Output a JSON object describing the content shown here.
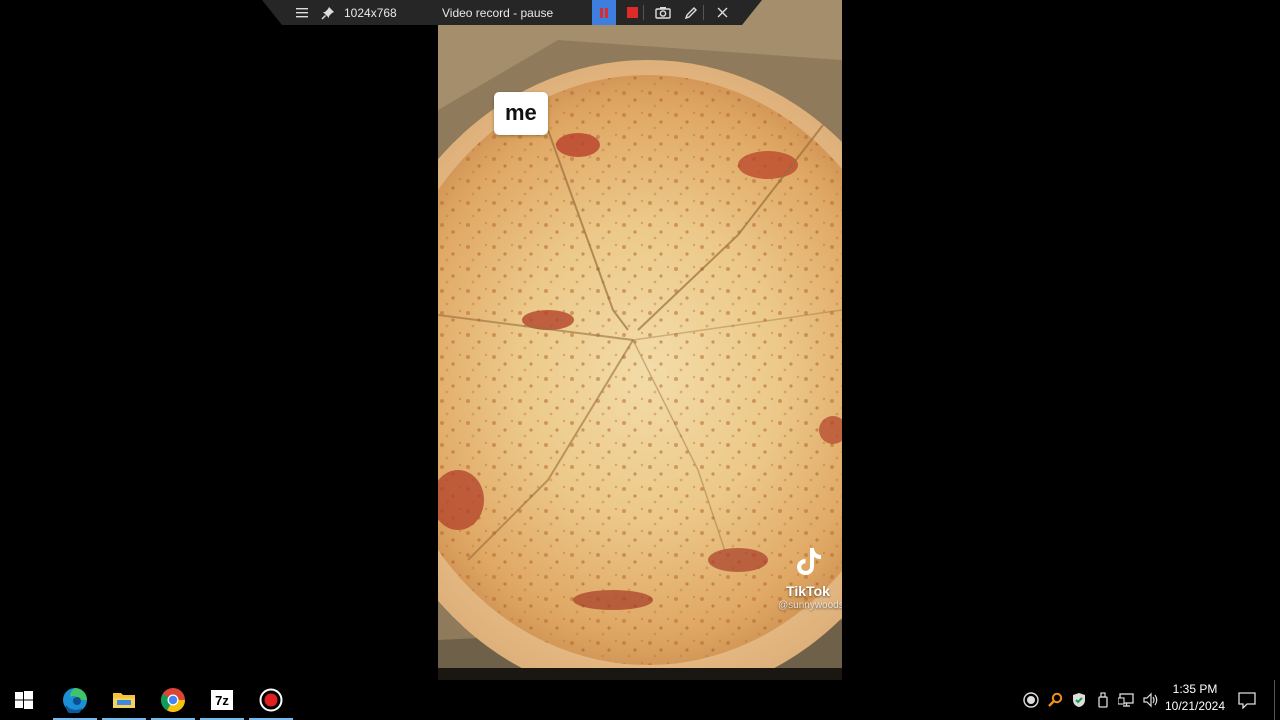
{
  "recorder_toolbar": {
    "resolution": "1024x768",
    "status": "Video record - pause",
    "menu_icon": "hamburger-menu-icon",
    "pin_icon": "pin-icon",
    "pause_icon": "pause-icon",
    "stop_icon": "stop-icon",
    "camera_icon": "camera-icon",
    "pen_icon": "pen-icon",
    "close_icon": "close-icon",
    "pause_color": "#3d7ede",
    "stop_color": "#e02a2a"
  },
  "video": {
    "caption": "me",
    "brand": "TikTok",
    "username": "@sunnywoods"
  },
  "taskbar": {
    "apps": [
      {
        "name": "start",
        "icon": "windows-logo-icon"
      },
      {
        "name": "edge",
        "icon": "edge-icon"
      },
      {
        "name": "file-explorer",
        "icon": "folder-icon"
      },
      {
        "name": "chrome",
        "icon": "chrome-icon"
      },
      {
        "name": "7-zip",
        "icon": "7zip-icon",
        "label": "7z"
      },
      {
        "name": "screen-recorder",
        "icon": "record-icon"
      }
    ],
    "tray": {
      "icons": [
        "record-status-icon",
        "search-key-icon",
        "security-shield-icon",
        "usb-device-icon",
        "network-icon",
        "volume-icon"
      ],
      "time": "1:35 PM",
      "date": "10/21/2024",
      "notification_icon": "notification-icon"
    },
    "accent": "#76b9ed"
  }
}
